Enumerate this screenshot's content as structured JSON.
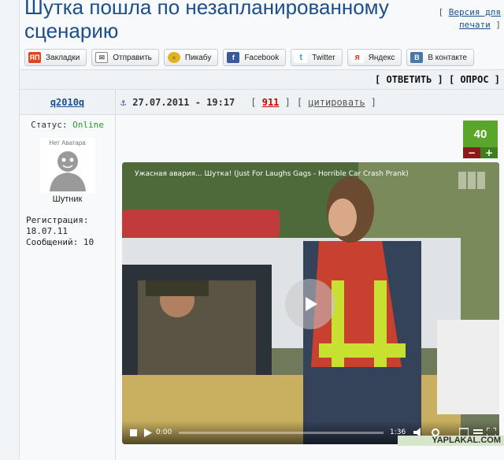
{
  "topic": {
    "title": "Шутка пошла по незапланированному сценарию",
    "print_open": "[",
    "print_label": "Версия для печати",
    "print_close": "]"
  },
  "share": [
    {
      "label": "Закладки",
      "icon": "yap-bookmarks-icon",
      "glyph": "ЯП"
    },
    {
      "label": "Отправить",
      "icon": "mail-icon",
      "glyph": "✉"
    },
    {
      "label": "Пикабу",
      "icon": "pikabu-icon",
      "glyph": "●"
    },
    {
      "label": "Facebook",
      "icon": "facebook-icon",
      "glyph": "f"
    },
    {
      "label": "Twitter",
      "icon": "twitter-icon",
      "glyph": "t"
    },
    {
      "label": "Яндекс",
      "icon": "yandex-icon",
      "glyph": "я"
    },
    {
      "label": "В контакте",
      "icon": "vkontakte-icon",
      "glyph": "В"
    }
  ],
  "actions": {
    "reply": "ОТВЕТИТЬ",
    "poll": "ОПРОС"
  },
  "user": {
    "name": "q2010q",
    "status_label": "Статус:",
    "status_value": "Online",
    "avatar_text": "Нет Аватара",
    "rank": "Шутник",
    "reg_label": "Регистрация:",
    "reg_date": "18.07.11",
    "messages_label": "Сообщений:",
    "messages_count": "10"
  },
  "post": {
    "anchor_icon": "⚓",
    "date": "27.07.2011 - 19:17",
    "number": "911",
    "quote_label": "цитировать",
    "rating": "40",
    "rating_minus": "−",
    "rating_plus": "+"
  },
  "video": {
    "title": "Ужасная авария... Шутка! (Just For Laughs Gags - Horrible Car Crash Prank)",
    "current_time": "0:00",
    "duration": "1:36"
  },
  "watermark": "YAPLAKAL.COM",
  "colors": {
    "link": "#1d4e8c",
    "online": "#2a9a2a",
    "rating_bg": "#5aa62a",
    "post_number": "#c00000"
  }
}
